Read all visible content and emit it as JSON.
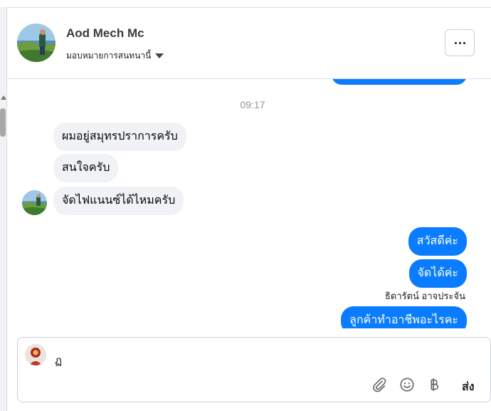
{
  "header": {
    "contact_name": "Aod Mech Mc",
    "assign_label": "มอบหมายการสนทนานี้",
    "avatar_icon": "contact-avatar-photo",
    "more_icon": "more-options-icon"
  },
  "thread": {
    "timestamp": "09:17",
    "incoming": [
      {
        "text": "ผมอยู่สมุทรปราการครับ"
      },
      {
        "text": "สนใจครับ"
      },
      {
        "text": "จัดไฟแนนซ์ได้ไหมครับ"
      }
    ],
    "outgoing": [
      {
        "text": "สวัสดีค่ะ"
      },
      {
        "text": "จัดได้ค่ะ"
      },
      {
        "text": "ลูกค้าทำอาชีพอะไรคะ"
      }
    ],
    "sender_name": "ธิดารัตน์ อาจประจัน"
  },
  "composer": {
    "value": "ฏ",
    "attach_icon": "paperclip-icon",
    "emoji_icon": "smiley-icon",
    "payment_icon": "baht-icon",
    "send_label": "ส่ง"
  },
  "colors": {
    "outgoing_bubble": "#0a7cff",
    "incoming_bubble": "#f0f2f5"
  }
}
